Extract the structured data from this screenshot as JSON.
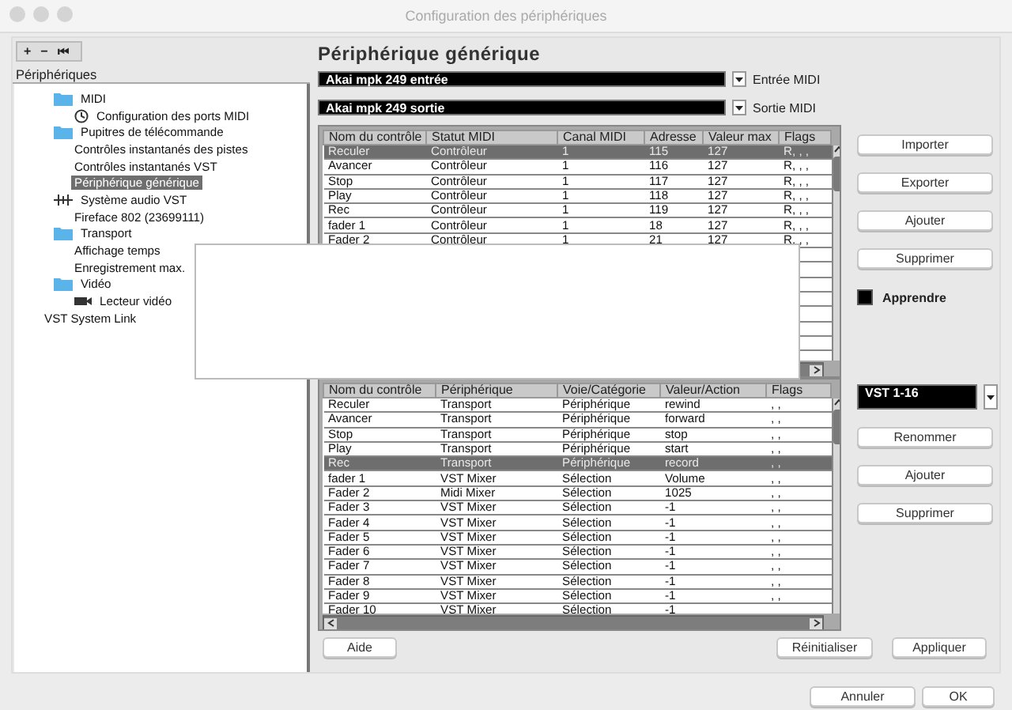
{
  "window": {
    "title": "Configuration des périphériques"
  },
  "sidebar": {
    "toolbar": [
      "+",
      "−",
      "⏮"
    ],
    "header": "Périphériques",
    "items": [
      {
        "label": "MIDI",
        "kind": "folder",
        "selected": false,
        "children": [
          {
            "label": "Configuration des ports MIDI",
            "kind": "setup",
            "selected": false
          }
        ]
      },
      {
        "label": "Pupitres de télécommande",
        "kind": "folder",
        "selected": false,
        "children": [
          {
            "label": "Contrôles instantanés des pistes",
            "kind": "item",
            "selected": false
          },
          {
            "label": "Contrôles instantanés VST",
            "kind": "item",
            "selected": false
          },
          {
            "label": "Périphérique générique",
            "kind": "item",
            "selected": true
          }
        ]
      },
      {
        "label": "Système audio VST",
        "kind": "system",
        "selected": false,
        "children": [
          {
            "label": "Fireface 802 (23699111)",
            "kind": "item",
            "selected": false
          }
        ]
      },
      {
        "label": "Transport",
        "kind": "folder",
        "selected": false,
        "children": [
          {
            "label": "Affichage temps",
            "kind": "item",
            "selected": false
          },
          {
            "label": "Enregistrement max.",
            "kind": "item",
            "selected": false
          }
        ]
      },
      {
        "label": "Vidéo",
        "kind": "folder",
        "selected": false,
        "children": [
          {
            "label": "Lecteur vidéo",
            "kind": "device",
            "selected": false
          }
        ]
      },
      {
        "label": "VST System Link",
        "kind": "plain",
        "selected": false
      }
    ]
  },
  "panel": {
    "title": "Périphérique générique",
    "midi_input": {
      "value": "Akai mpk 249 entrée",
      "label": "Entrée MIDI"
    },
    "midi_output": {
      "value": "Akai mpk 249 sortie",
      "label": "Sortie MIDI"
    },
    "controls_table": {
      "columns": [
        "Nom du contrôle",
        "Statut MIDI",
        "Canal MIDI",
        "Adresse",
        "Valeur max",
        "Flags"
      ],
      "rows": [
        {
          "cells": [
            "Reculer",
            "Contrôleur",
            "1",
            "115",
            "127",
            "R, , ,"
          ],
          "selected": true
        },
        {
          "cells": [
            "Avancer",
            "Contrôleur",
            "1",
            "116",
            "127",
            "R, , ,"
          ],
          "selected": false
        },
        {
          "cells": [
            "Stop",
            "Contrôleur",
            "1",
            "117",
            "127",
            "R, , ,"
          ],
          "selected": false
        },
        {
          "cells": [
            "Play",
            "Contrôleur",
            "1",
            "118",
            "127",
            "R, , ,"
          ],
          "selected": false
        },
        {
          "cells": [
            "Rec",
            "Contrôleur",
            "1",
            "119",
            "127",
            "R, , ,"
          ],
          "selected": false
        },
        {
          "cells": [
            "fader 1",
            "Contrôleur",
            "1",
            "18",
            "127",
            "R, , ,"
          ],
          "selected": false
        },
        {
          "cells": [
            "Fader 2",
            "Contrôleur",
            "1",
            "21",
            "127",
            "R, , ,"
          ],
          "selected": false
        }
      ]
    },
    "controls_buttons": [
      "Importer",
      "Exporter",
      "Ajouter",
      "Supprimer"
    ],
    "learn": {
      "label": "Apprendre",
      "checked": false
    },
    "bank": {
      "value": "VST 1-16"
    },
    "bank_buttons": [
      "Renommer",
      "Ajouter",
      "Supprimer"
    ],
    "assign_table": {
      "columns": [
        "Nom du contrôle",
        "Périphérique",
        "Voie/Catégorie",
        "Valeur/Action",
        "Flags"
      ],
      "rows": [
        {
          "cells": [
            "Reculer",
            "Transport",
            "Périphérique",
            "rewind",
            ", ,"
          ],
          "selected": false
        },
        {
          "cells": [
            "Avancer",
            "Transport",
            "Périphérique",
            "forward",
            ", ,"
          ],
          "selected": false
        },
        {
          "cells": [
            "Stop",
            "Transport",
            "Périphérique",
            "stop",
            ", ,"
          ],
          "selected": false
        },
        {
          "cells": [
            "Play",
            "Transport",
            "Périphérique",
            "start",
            ", ,"
          ],
          "selected": false
        },
        {
          "cells": [
            "Rec",
            "Transport",
            "Périphérique",
            "record",
            ", ,"
          ],
          "selected": true
        },
        {
          "cells": [
            "fader 1",
            "VST Mixer",
            "Sélection",
            "Volume",
            ", ,"
          ],
          "selected": false
        },
        {
          "cells": [
            "Fader 2",
            "Midi Mixer",
            "Sélection",
            "1025",
            ", ,"
          ],
          "selected": false
        },
        {
          "cells": [
            "Fader 3",
            "VST Mixer",
            "Sélection",
            "-1",
            ", ,"
          ],
          "selected": false
        },
        {
          "cells": [
            "Fader 4",
            "VST Mixer",
            "Sélection",
            "-1",
            ", ,"
          ],
          "selected": false
        },
        {
          "cells": [
            "Fader 5",
            "VST Mixer",
            "Sélection",
            "-1",
            ", ,"
          ],
          "selected": false
        },
        {
          "cells": [
            "Fader 6",
            "VST Mixer",
            "Sélection",
            "-1",
            ", ,"
          ],
          "selected": false
        },
        {
          "cells": [
            "Fader 7",
            "VST Mixer",
            "Sélection",
            "-1",
            ", ,"
          ],
          "selected": false
        },
        {
          "cells": [
            "Fader 8",
            "VST Mixer",
            "Sélection",
            "-1",
            ", ,"
          ],
          "selected": false
        },
        {
          "cells": [
            "Fader 9",
            "VST Mixer",
            "Sélection",
            "-1",
            ", ,"
          ],
          "selected": false
        },
        {
          "cells": [
            "Fader 10",
            "VST Mixer",
            "Sélection",
            "-1",
            ""
          ],
          "selected": false
        }
      ]
    },
    "help_button": "Aide",
    "reset_button": "Réinitialiser",
    "apply_button": "Appliquer"
  },
  "footer": {
    "buttons": [
      "Annuler",
      "OK"
    ]
  }
}
